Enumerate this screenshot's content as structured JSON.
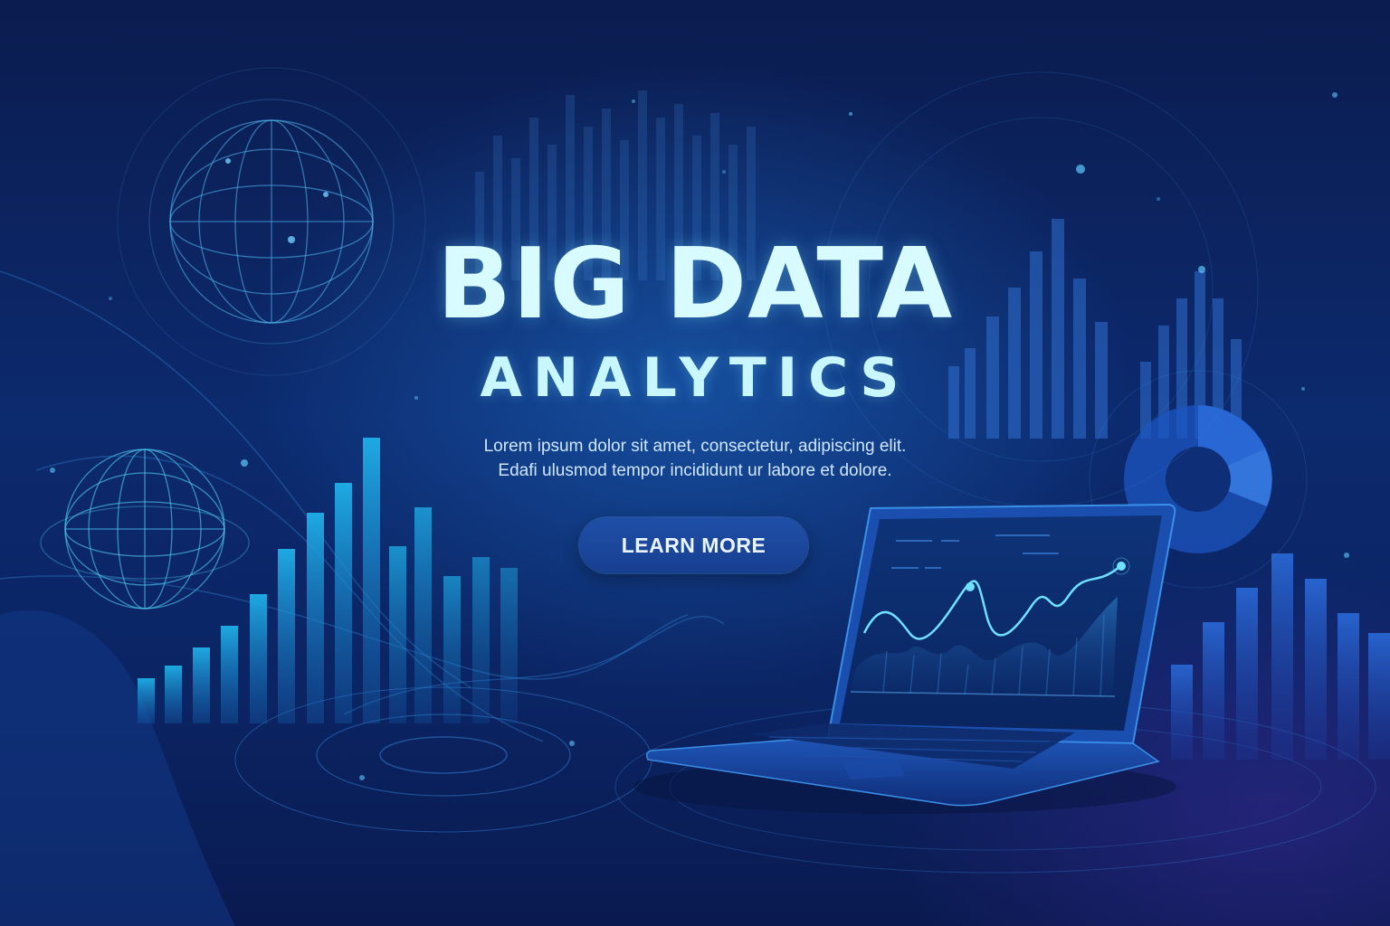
{
  "hero": {
    "title": "BIG DATA",
    "subtitle": "ANALYTICS",
    "description_line1": "Lorem ipsum dolor sit amet, consectetur, adipiscing elit.",
    "description_line2": "Edafi ulusmod tempor incididunt ur labore et dolore.",
    "cta_label": "LEARN MORE"
  },
  "colors": {
    "background_top": "#0b1c4f",
    "background_mid": "#0c2a6e",
    "title_text": "#d8fbff",
    "button_bg": "#1f4fa8",
    "bar_accent": "#1e9fd8",
    "chart_line": "#5fdcff"
  },
  "icons": [
    "globe-icon",
    "bar-chart-icon",
    "pie-chart-icon",
    "laptop-icon",
    "line-chart-icon"
  ]
}
